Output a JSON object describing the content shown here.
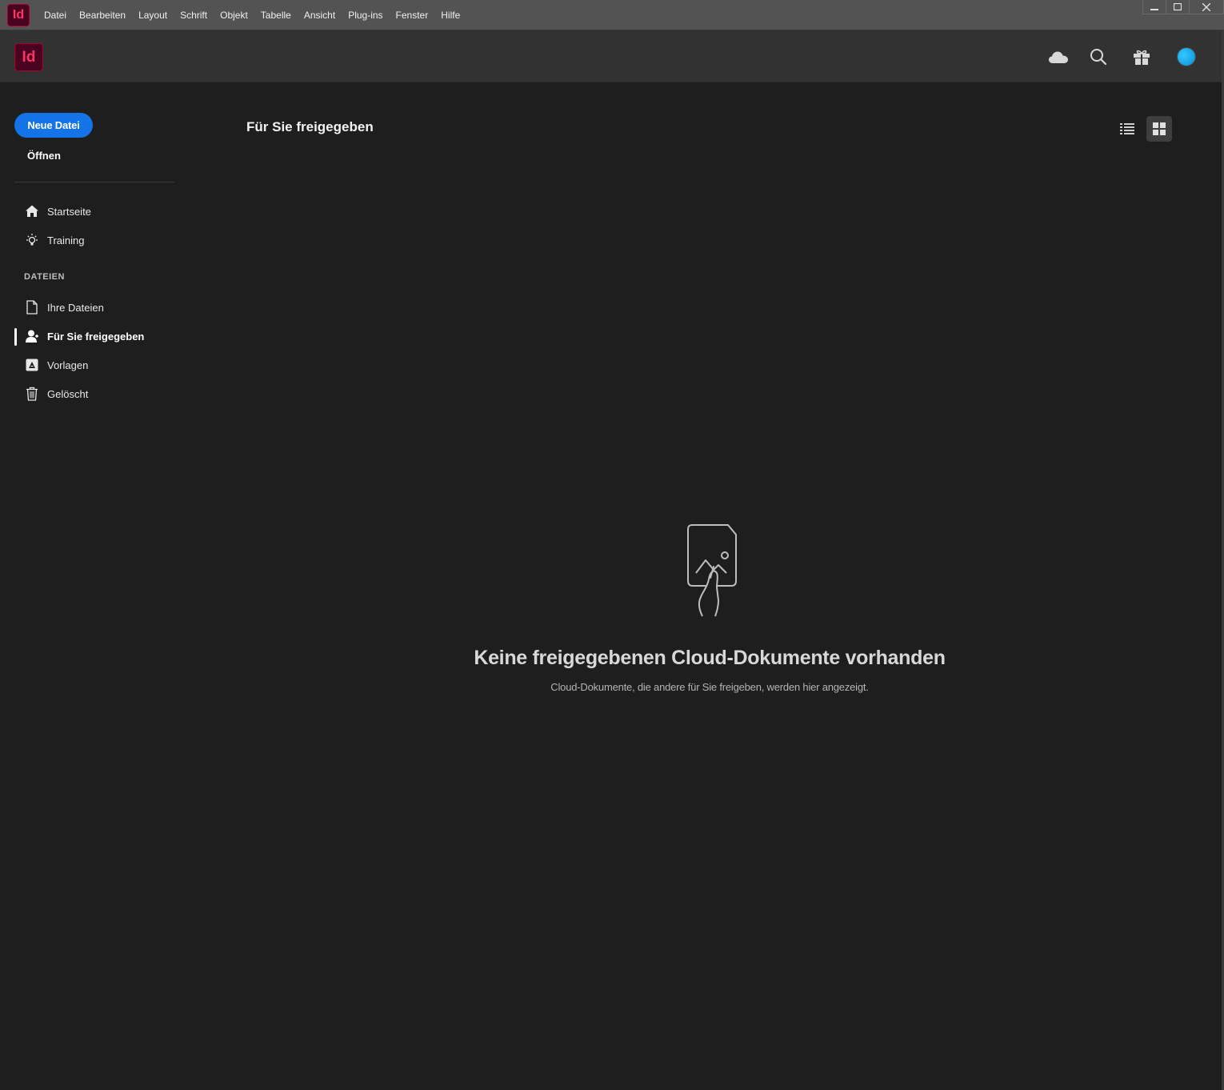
{
  "app": {
    "badge_label": "Id",
    "accent": "#ff3366",
    "badge_bg": "#49021f"
  },
  "menubar": {
    "items": [
      "Datei",
      "Bearbeiten",
      "Layout",
      "Schrift",
      "Objekt",
      "Tabelle",
      "Ansicht",
      "Plug-ins",
      "Fenster",
      "Hilfe"
    ],
    "window_controls": {
      "minimize": "🗕",
      "maximize": "🗖",
      "close": "✕"
    }
  },
  "header": {
    "icons": [
      "cloud-icon",
      "search-icon",
      "gift-icon",
      "avatar"
    ]
  },
  "sidebar": {
    "new_file": "Neue Datei",
    "open": "Öffnen",
    "section_files": "DATEIEN",
    "nav_top": [
      {
        "label": "Startseite",
        "icon": "home-icon"
      },
      {
        "label": "Training",
        "icon": "lightbulb-icon"
      }
    ],
    "nav_files": [
      {
        "label": "Ihre Dateien",
        "icon": "file-icon"
      },
      {
        "label": "Für Sie freigegeben",
        "icon": "user-shared-icon",
        "active": true
      },
      {
        "label": "Vorlagen",
        "icon": "template-icon"
      },
      {
        "label": "Gelöscht",
        "icon": "trash-icon"
      }
    ]
  },
  "main": {
    "title": "Für Sie freigegeben",
    "view_modes": [
      "list-view-icon",
      "grid-view-icon"
    ],
    "selected_view": "grid",
    "empty_state": {
      "title": "Keine freigegebenen Cloud-Dokumente vorhanden",
      "subtitle": "Cloud-Dokumente, die andere für Sie freigeben, werden hier angezeigt."
    }
  },
  "colors": {
    "primary_button": "#1473e6",
    "background": "#1e1e1e",
    "menubar": "#535353",
    "header": "#323232"
  }
}
